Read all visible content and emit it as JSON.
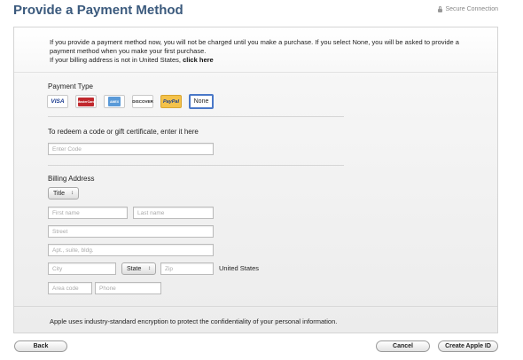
{
  "header": {
    "title": "Provide a Payment Method",
    "secure_label": "Secure Connection"
  },
  "intro": {
    "text": "If you provide a payment method now, you will not be charged until you make a purchase. If you select None, you will be asked to provide a payment method when you make your first purchase.",
    "billing_prefix": "If your billing address is not in United States,",
    "billing_link": "click here"
  },
  "payment": {
    "label": "Payment Type",
    "types": [
      {
        "name": "visa",
        "label": "VISA"
      },
      {
        "name": "mastercard",
        "label": "MasterCard"
      },
      {
        "name": "amex",
        "label": "AMEX"
      },
      {
        "name": "discover",
        "label": "DISCOVER"
      },
      {
        "name": "paypal",
        "label": "PayPal"
      },
      {
        "name": "none",
        "label": "None"
      }
    ],
    "selected": "None"
  },
  "redeem": {
    "label": "To redeem a code or gift certificate, enter it here",
    "placeholder": "Enter Code"
  },
  "billing": {
    "label": "Billing Address",
    "title_select": "Title",
    "first_name": "First name",
    "last_name": "Last name",
    "street": "Street",
    "apt": "Apt., suite, bldg.",
    "city": "City",
    "state_select": "State",
    "zip": "Zip",
    "country": "United States",
    "area_code": "Area code",
    "phone": "Phone"
  },
  "footer_note": "Apple uses industry-standard encryption to protect the confidentiality of your personal information.",
  "buttons": {
    "back": "Back",
    "cancel": "Cancel",
    "create": "Create Apple ID"
  }
}
